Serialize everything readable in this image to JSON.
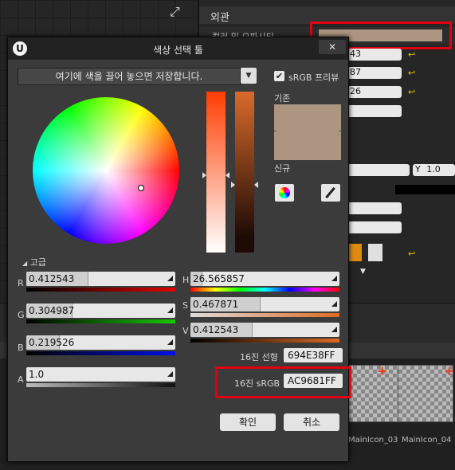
{
  "editor": {
    "section_title": "외관",
    "color_prop_label": "컬러 및 오파시티",
    "y_label": "Y",
    "y_value": "1.0",
    "field_values": [
      "43",
      "87",
      "26"
    ],
    "thumb_labels": [
      "MainIcon_03",
      "MainIcon_04"
    ],
    "highlight_color": "#e00012",
    "preview_color": "#ac9681"
  },
  "dialog": {
    "title": "색상 선택 툴",
    "logo": "U",
    "close_icon": "close-icon",
    "drop_hint": "여기에 색을 끌어 놓으면 저장합니다.",
    "srgb_label": "sRGB 프리뷰",
    "srgb_checked": "✔",
    "old_label": "기존",
    "new_label": "신규",
    "advanced_label": "고급",
    "channels": {
      "r": {
        "label": "R",
        "value": "0.412543",
        "fraction": 0.412543
      },
      "g": {
        "label": "G",
        "value": "0.304987",
        "fraction": 0.304987
      },
      "b": {
        "label": "B",
        "value": "0.219526",
        "fraction": 0.219526
      },
      "a": {
        "label": "A",
        "value": "1.0",
        "fraction": 1.0
      },
      "h": {
        "label": "H",
        "value": "26.565857",
        "fraction": 0.0738
      },
      "s": {
        "label": "S",
        "value": "0.467871",
        "fraction": 0.467871
      },
      "v": {
        "label": "V",
        "value": "0.412543",
        "fraction": 0.412543
      }
    },
    "hex_linear_label": "16진 선형",
    "hex_linear_value": "694E38FF",
    "hex_srgb_label": "16진 sRGB",
    "hex_srgb_value": "AC9681FF",
    "ok_label": "확인",
    "cancel_label": "취소",
    "current_color": "#ac9681"
  }
}
